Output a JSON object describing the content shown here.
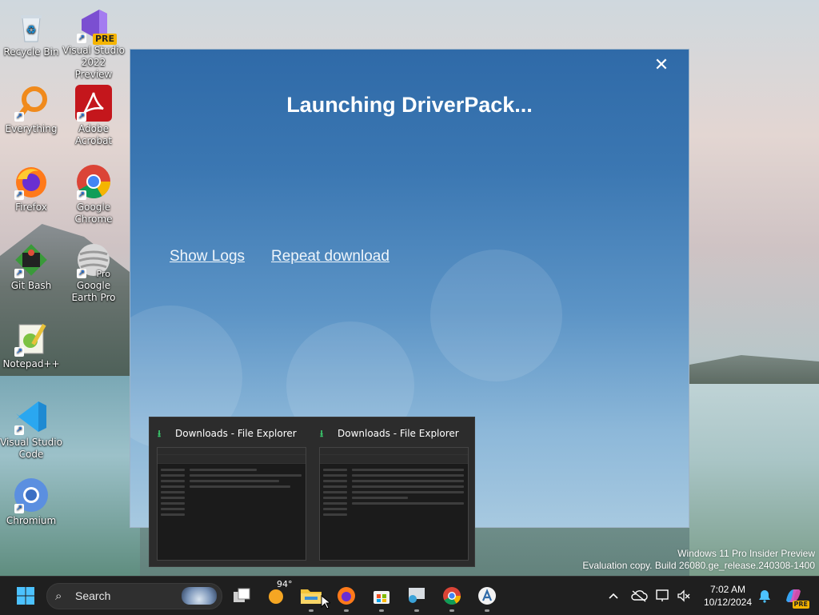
{
  "desktop": {
    "icons": [
      {
        "label": "Recycle Bin"
      },
      {
        "label": "Visual Studio 2022 Preview",
        "badge": "PRE"
      },
      {
        "label": "Everything"
      },
      {
        "label": "Adobe Acrobat"
      },
      {
        "label": "Firefox"
      },
      {
        "label": "Google Chrome"
      },
      {
        "label": "Git Bash"
      },
      {
        "label": "Google Earth Pro",
        "badge": "Pro"
      },
      {
        "label": "Notepad++"
      },
      {
        "label": "Visual Studio Code"
      },
      {
        "label": "Chromium"
      }
    ]
  },
  "launcher": {
    "title": "Launching DriverPack...",
    "close_glyph": "✕",
    "show_logs": "Show Logs",
    "repeat_download": "Repeat download"
  },
  "thumbnails": [
    {
      "title": "Downloads - File Explorer"
    },
    {
      "title": "Downloads - File Explorer"
    }
  ],
  "watermark": {
    "line1": "Windows 11 Pro Insider Preview",
    "line2": "Evaluation copy. Build 26080.ge_release.240308-1400"
  },
  "taskbar": {
    "search_placeholder": "Search",
    "weather_temp": "94°",
    "clock_time": "7:02 AM",
    "clock_date": "10/12/2024",
    "copilot_badge": "PRE"
  },
  "colors": {
    "launcher_top": "#2f6aa8",
    "taskbar_bg": "#1f1f1f",
    "download_green": "#39c46a"
  }
}
